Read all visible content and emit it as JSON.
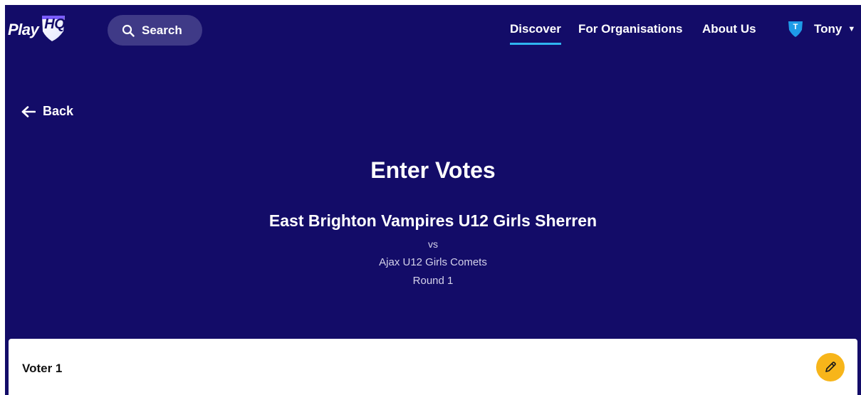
{
  "header": {
    "logo_text": "Play",
    "logo_badge": "HQ",
    "search_label": "Search",
    "nav": [
      {
        "label": "Discover",
        "active": true
      },
      {
        "label": "For Organisations",
        "active": false
      },
      {
        "label": "About Us",
        "active": false
      }
    ],
    "user": {
      "initial": "T",
      "name": "Tony"
    }
  },
  "back_label": "Back",
  "match": {
    "title": "Enter Votes",
    "home_team": "East Brighton Vampires U12 Girls Sherren",
    "vs": "vs",
    "away_team": "Ajax U12 Girls Comets",
    "round": "Round 1"
  },
  "voters": [
    {
      "label": "Voter 1"
    }
  ],
  "colors": {
    "background": "#130c68",
    "accent": "#2fb5f0",
    "edit_button": "#f7b51a"
  }
}
